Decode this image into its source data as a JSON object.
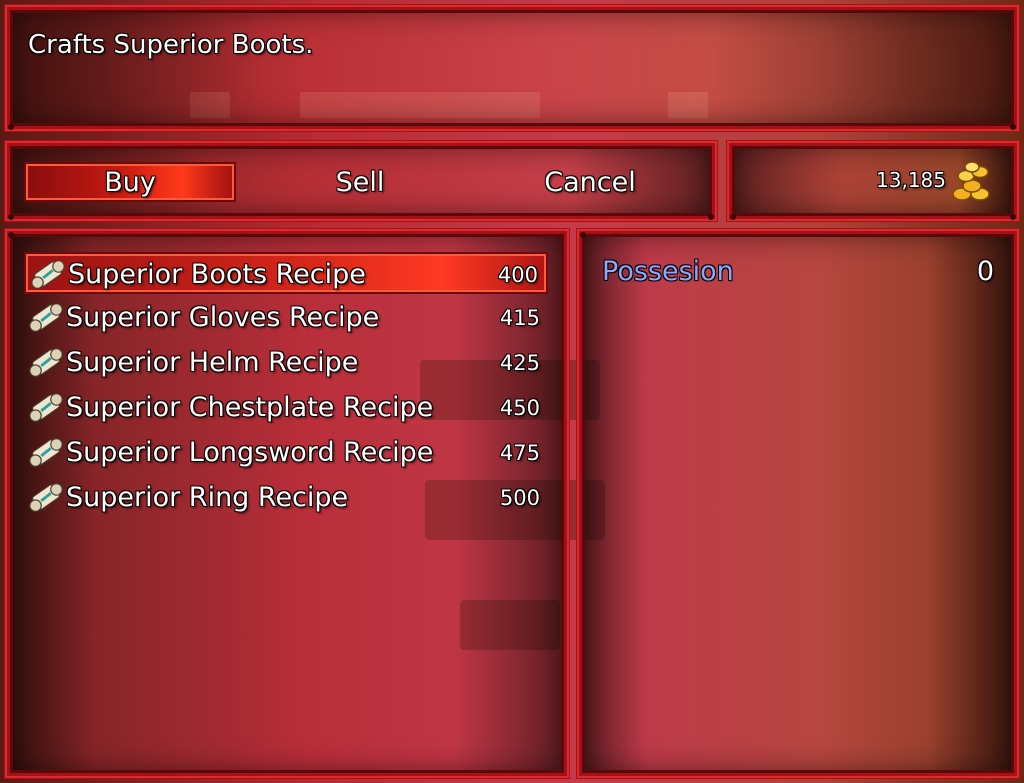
{
  "help": {
    "text": "Crafts Superior Boots."
  },
  "commands": {
    "buy": "Buy",
    "sell": "Sell",
    "cancel": "Cancel",
    "selected": "Buy"
  },
  "gold": {
    "value": "13,185",
    "icon": "gold-coins-icon"
  },
  "items": [
    {
      "name": "Superior Boots Recipe",
      "price": "400",
      "icon": "scroll-icon",
      "selected": true
    },
    {
      "name": "Superior Gloves Recipe",
      "price": "415",
      "icon": "scroll-icon",
      "selected": false
    },
    {
      "name": "Superior Helm Recipe",
      "price": "425",
      "icon": "scroll-icon",
      "selected": false
    },
    {
      "name": "Superior Chestplate Recipe",
      "price": "450",
      "icon": "scroll-icon",
      "selected": false
    },
    {
      "name": "Superior Longsword Recipe",
      "price": "475",
      "icon": "scroll-icon",
      "selected": false
    },
    {
      "name": "Superior Ring Recipe",
      "price": "500",
      "icon": "scroll-icon",
      "selected": false
    }
  ],
  "status": {
    "possession_label": "Possesion",
    "possession_value": "0"
  },
  "colors": {
    "frame": "#a3121a",
    "frame_highlight": "#e02a2a",
    "selection": "#d8261a",
    "possession_label": "#8aa8ff"
  }
}
